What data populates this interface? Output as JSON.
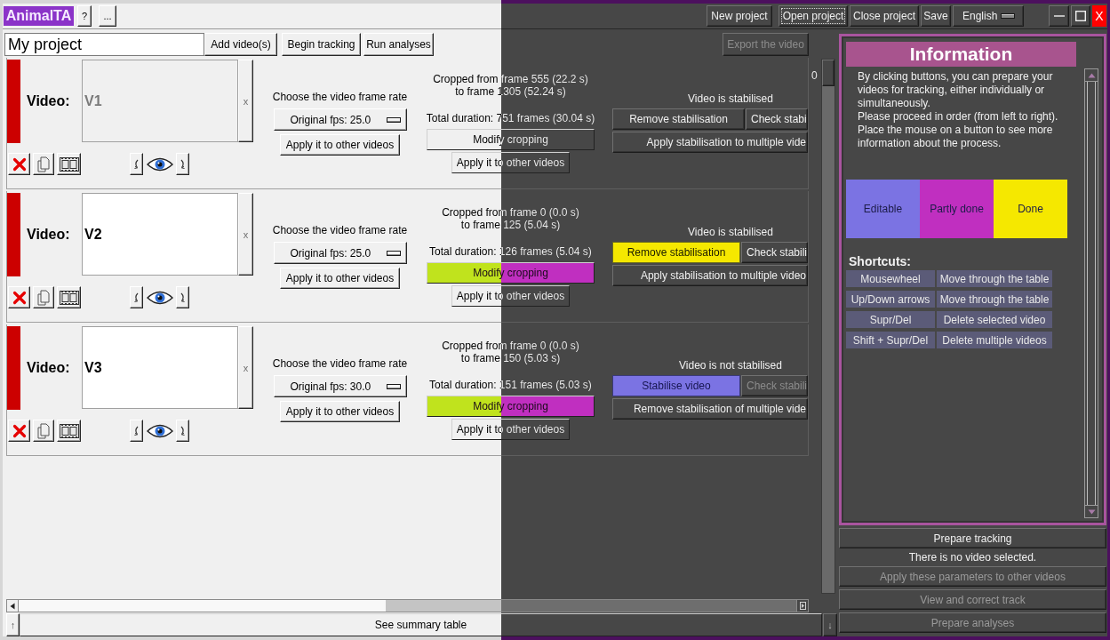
{
  "title_bar": {
    "logo": "AnimalTA",
    "help_button": "?",
    "more_button": "...",
    "project_buttons": [
      {
        "label": "New project",
        "focused": false
      },
      {
        "label": "Open project",
        "focused": true
      },
      {
        "label": "Close project",
        "focused": false
      },
      {
        "label": "Save",
        "focused": false
      }
    ],
    "language": "English",
    "close_button": "X"
  },
  "project_bar": {
    "project_name": "My project",
    "buttons": [
      "Add video(s)",
      "Begin tracking",
      "Run analyses"
    ],
    "export_button": {
      "label": "Export the video",
      "disabled": true
    }
  },
  "videos": [
    {
      "label": "Video:",
      "name": "V1",
      "disabled": true,
      "remove_button": "x",
      "frame_rate_title": "Choose the video frame rate",
      "frame_rate": "Original fps: 25.0",
      "frame_rate_apply": "Apply it to other videos",
      "crop_info": "Cropped from frame 555 (22.2 s)\nto frame 1305 (52.24 s)",
      "duration": "Total duration: 751 frames (30.04 s)",
      "crop_button": {
        "label": "Modify cropping",
        "kind": "plain"
      },
      "crop_apply": "Apply it to other videos",
      "stabilisation_state": "Video is stabilised",
      "stabilise_button": {
        "label": "Remove stabilisation",
        "kind": "plain"
      },
      "check_button": {
        "label": "Check stabi",
        "disabled": false
      },
      "multiple_button": "Apply stabilisation to multiple vide"
    },
    {
      "label": "Video:",
      "name": "V2",
      "disabled": false,
      "remove_button": "x",
      "frame_rate_title": "Choose the video frame rate",
      "frame_rate": "Original fps: 25.0",
      "frame_rate_apply": "Apply it to other videos",
      "crop_info": "Cropped from frame 0 (0.0 s)\nto frame 125 (5.04 s)",
      "duration": "Total duration: 126 frames (5.04 s)",
      "crop_button": {
        "label": "Modify cropping",
        "kind": "partial"
      },
      "crop_apply": "Apply it to other videos",
      "stabilisation_state": "Video is stabilised",
      "stabilise_button": {
        "label": "Remove stabilisation",
        "kind": "done"
      },
      "check_button": {
        "label": "Check stabili",
        "disabled": false
      },
      "multiple_button": "Apply stabilisation to multiple video"
    },
    {
      "label": "Video:",
      "name": "V3",
      "disabled": false,
      "remove_button": "x",
      "frame_rate_title": "Choose the video frame rate",
      "frame_rate": "Original fps: 30.0",
      "frame_rate_apply": "Apply it to other videos",
      "crop_info": "Cropped from frame 0 (0.0 s)\nto frame 150 (5.03 s)",
      "duration": "Total duration: 151 frames (5.03 s)",
      "crop_button": {
        "label": "Modify cropping",
        "kind": "partial"
      },
      "crop_apply": "Apply it to other videos",
      "stabilisation_state": "Video is not stabilised",
      "stabilise_button": {
        "label": "Stabilise video",
        "kind": "editable"
      },
      "check_button": {
        "label": "Check stabili",
        "disabled": true
      },
      "multiple_button": "Remove stabilisation of multiple vide"
    }
  ],
  "table_scroll_label": "0",
  "bottom_bar": {
    "up_button": "↑",
    "summary_button": "See summary table",
    "down_button": "↓"
  },
  "information": {
    "title": "Information",
    "text": "By clicking buttons, you can prepare your videos for tracking, either individually or simultaneously.\nPlease proceed in order (from left to right).\nPlace the mouse on a button to see more information about the process.",
    "legend": [
      {
        "label": "Editable",
        "color": "#7b73e3"
      },
      {
        "label": "Partly done",
        "color": "#c02fc0"
      },
      {
        "label": "Done",
        "color": "#f5e800"
      }
    ],
    "shortcuts_title": "Shortcuts:",
    "shortcuts": [
      {
        "keys": "Mousewheel",
        "action": "Move through the table"
      },
      {
        "keys": "Up/Down arrows",
        "action": "Move through the table"
      },
      {
        "keys": "Supr/Del",
        "action": "Delete selected video"
      },
      {
        "keys": "Shift + Supr/Del",
        "action": "Delete multiple videos"
      }
    ]
  },
  "side_actions": {
    "prepare_tracking": {
      "label": "Prepare tracking",
      "disabled": false
    },
    "message": "There is no video selected.",
    "buttons": [
      {
        "label": "Apply these parameters to other videos",
        "disabled": true
      },
      {
        "label": "View and correct track",
        "disabled": true
      },
      {
        "label": "Prepare analyses",
        "disabled": true
      }
    ]
  }
}
